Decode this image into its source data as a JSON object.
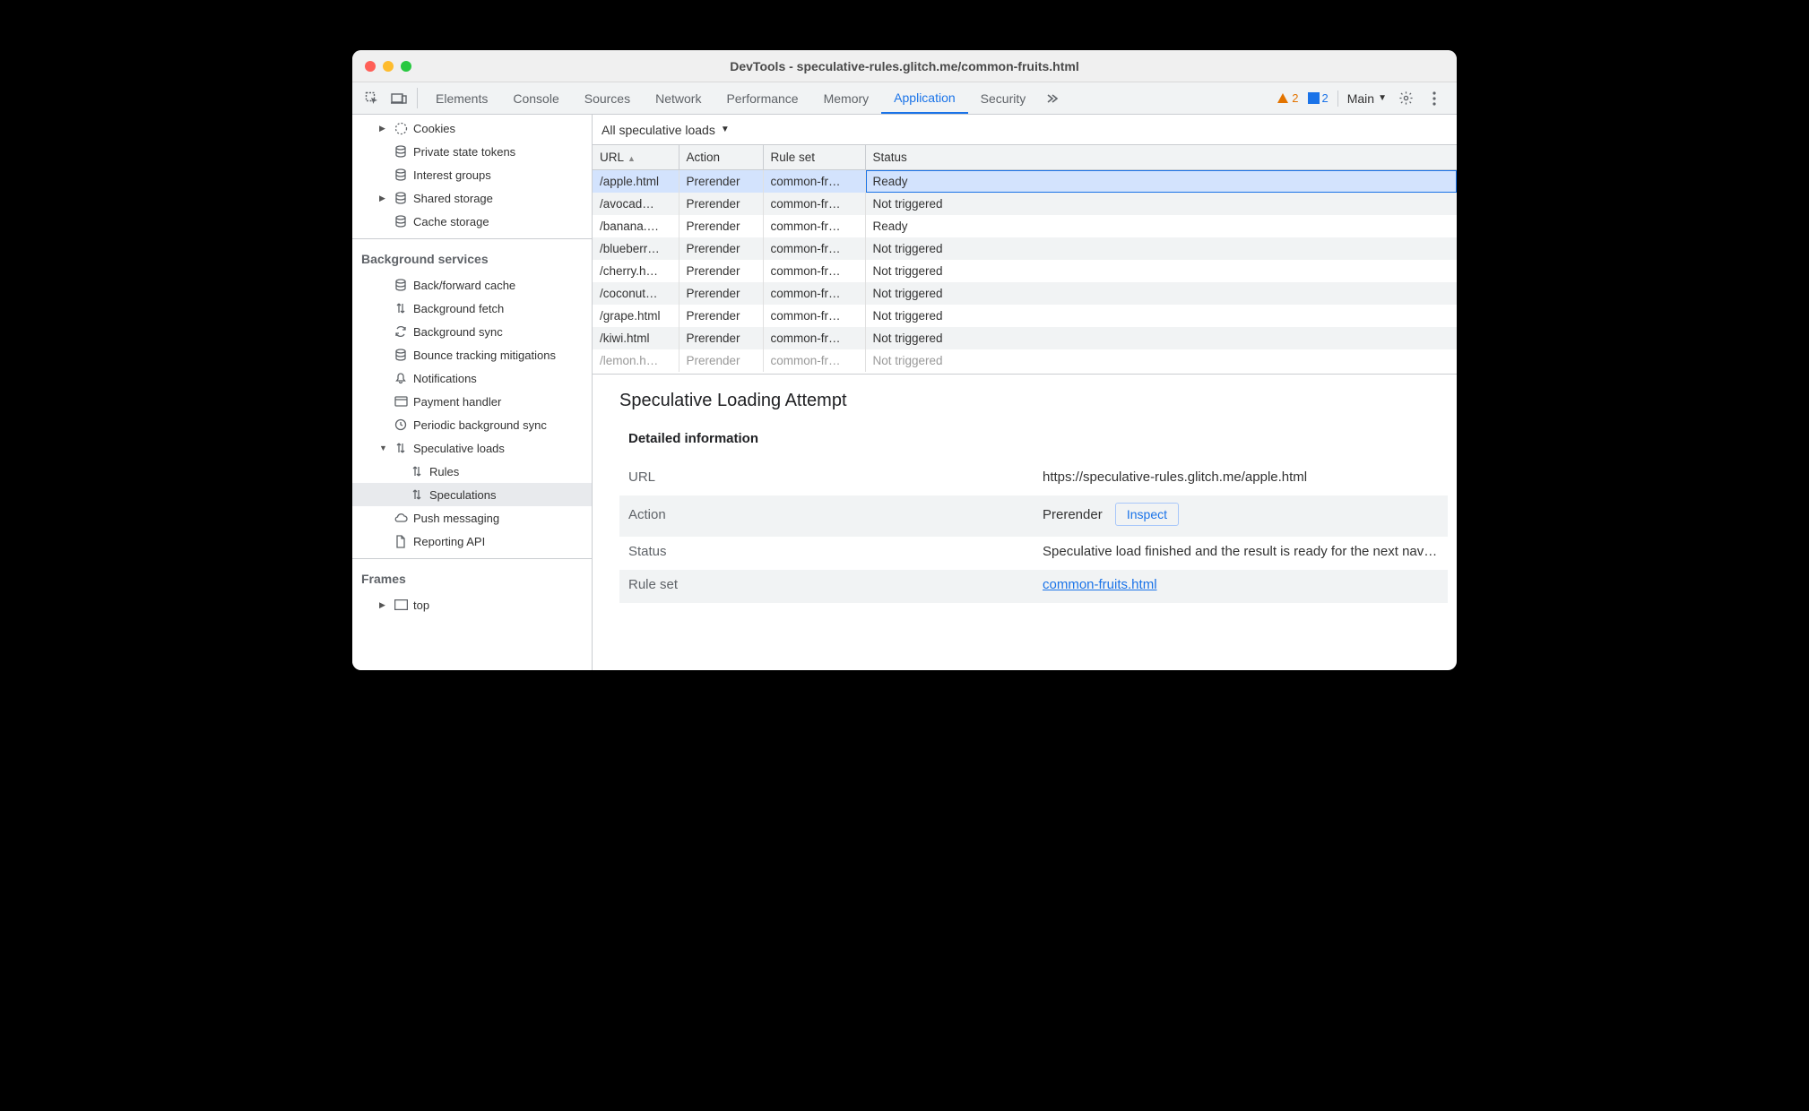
{
  "title": "DevTools - speculative-rules.glitch.me/common-fruits.html",
  "toolbar": {
    "tabs": [
      "Elements",
      "Console",
      "Sources",
      "Network",
      "Performance",
      "Memory",
      "Application",
      "Security"
    ],
    "active_tab": "Application",
    "warning_count": "2",
    "issue_count": "2",
    "context_label": "Main"
  },
  "sidebar": {
    "top_items": [
      {
        "label": "Cookies",
        "icon": "cookie",
        "expander": "▶"
      },
      {
        "label": "Private state tokens",
        "icon": "db",
        "expander": ""
      },
      {
        "label": "Interest groups",
        "icon": "db",
        "expander": ""
      },
      {
        "label": "Shared storage",
        "icon": "db",
        "expander": "▶"
      },
      {
        "label": "Cache storage",
        "icon": "db",
        "expander": ""
      }
    ],
    "bg_title": "Background services",
    "bg_items": [
      {
        "label": "Back/forward cache",
        "icon": "db"
      },
      {
        "label": "Background fetch",
        "icon": "arrows"
      },
      {
        "label": "Background sync",
        "icon": "sync"
      },
      {
        "label": "Bounce tracking mitigations",
        "icon": "db"
      },
      {
        "label": "Notifications",
        "icon": "bell"
      },
      {
        "label": "Payment handler",
        "icon": "card"
      },
      {
        "label": "Periodic background sync",
        "icon": "clock"
      },
      {
        "label": "Speculative loads",
        "icon": "arrows",
        "exp": "▼",
        "children": [
          {
            "label": "Rules",
            "icon": "arrows"
          },
          {
            "label": "Speculations",
            "icon": "arrows",
            "selected": true
          }
        ]
      },
      {
        "label": "Push messaging",
        "icon": "cloud"
      },
      {
        "label": "Reporting API",
        "icon": "doc"
      }
    ],
    "frames_title": "Frames",
    "frames_item": {
      "label": "top",
      "expander": "▶"
    }
  },
  "filter": {
    "label": "All speculative loads"
  },
  "columns": [
    "URL",
    "Action",
    "Rule set",
    "Status"
  ],
  "rows": [
    {
      "url": "/apple.html",
      "action": "Prerender",
      "ruleset": "common-fr…",
      "status": "Ready",
      "selected": true
    },
    {
      "url": "/avocad…",
      "action": "Prerender",
      "ruleset": "common-fr…",
      "status": "Not triggered"
    },
    {
      "url": "/banana.…",
      "action": "Prerender",
      "ruleset": "common-fr…",
      "status": "Ready"
    },
    {
      "url": "/blueberr…",
      "action": "Prerender",
      "ruleset": "common-fr…",
      "status": "Not triggered"
    },
    {
      "url": "/cherry.h…",
      "action": "Prerender",
      "ruleset": "common-fr…",
      "status": "Not triggered"
    },
    {
      "url": "/coconut…",
      "action": "Prerender",
      "ruleset": "common-fr…",
      "status": "Not triggered"
    },
    {
      "url": "/grape.html",
      "action": "Prerender",
      "ruleset": "common-fr…",
      "status": "Not triggered"
    },
    {
      "url": "/kiwi.html",
      "action": "Prerender",
      "ruleset": "common-fr…",
      "status": "Not triggered"
    },
    {
      "url": "/lemon.h…",
      "action": "Prerender",
      "ruleset": "common-fr…",
      "status": "Not triggered",
      "partial": true
    }
  ],
  "details": {
    "heading": "Speculative Loading Attempt",
    "section": "Detailed information",
    "labels": {
      "url": "URL",
      "action": "Action",
      "status": "Status",
      "ruleset": "Rule set"
    },
    "url": "https://speculative-rules.glitch.me/apple.html",
    "action": "Prerender",
    "inspect": "Inspect",
    "status_text": "Speculative load finished and the result is ready for the next navigation.",
    "ruleset_link": "common-fruits.html"
  }
}
